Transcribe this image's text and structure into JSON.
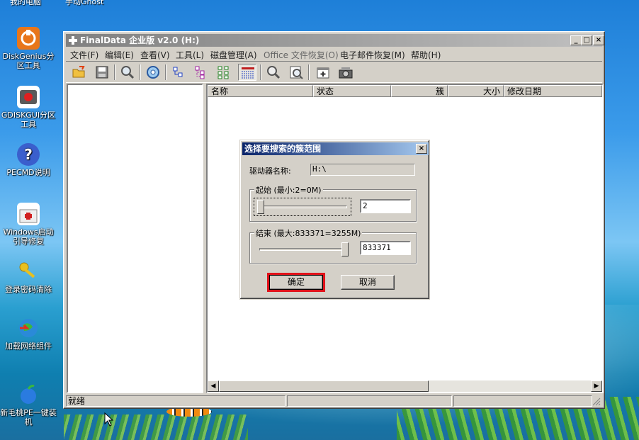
{
  "desktop": {
    "partial_labels": [
      "我的电脑",
      "手动Ghost"
    ],
    "icons": [
      {
        "label": "DiskGenius分区工具",
        "icon": "diskgenius-icon",
        "color": "#e8761a"
      },
      {
        "label": "GDISKGUI分区工具",
        "icon": "gdiskgui-icon",
        "color": "#5a5a5a"
      },
      {
        "label": "PECMD说明",
        "icon": "help-icon",
        "color": "#3a5fcd"
      },
      {
        "label": "Windows启动引导修复",
        "icon": "toolbox-icon",
        "color": "#d02020"
      },
      {
        "label": "登录密码清除",
        "icon": "key-icon",
        "color": "#e8c020"
      },
      {
        "label": "加载网络组件",
        "icon": "globe-icon",
        "color": "#2a8ad8"
      },
      {
        "label": "新毛桃PE一键装机",
        "icon": "peach-icon",
        "color": "#2a7be0"
      }
    ]
  },
  "window": {
    "title": "FinalData 企业版 v2.0 (H:)",
    "controls": {
      "minimize": "_",
      "maximize": "□",
      "close": "×"
    },
    "menu": [
      {
        "label": "文件(F)",
        "enabled": true
      },
      {
        "label": "编辑(E)",
        "enabled": true
      },
      {
        "label": "查看(V)",
        "enabled": true
      },
      {
        "label": "工具(L)",
        "enabled": true
      },
      {
        "label": "磁盘管理(A)",
        "enabled": true
      },
      {
        "label": "Office 文件恢复(O)",
        "enabled": false
      },
      {
        "label": "电子邮件恢复(M)",
        "enabled": true
      },
      {
        "label": "帮助(H)",
        "enabled": true
      }
    ],
    "toolbar_icons": [
      "open-folder-icon",
      "save-icon",
      "search-icon",
      "disc-icon",
      "tree-small-icon",
      "tree-medium-icon",
      "tree-large-icon",
      "list-view-icon",
      "magnify-icon",
      "preview-icon",
      "new-window-icon",
      "camera-icon"
    ],
    "columns": [
      "名称",
      "状态",
      "簇",
      "大小",
      "修改日期"
    ],
    "status": {
      "text": "就绪"
    }
  },
  "dialog": {
    "title": "选择要搜索的簇范围",
    "close": "×",
    "drive_label": "驱动器名称:",
    "drive_value": "H:\\",
    "start_group": "起始 (最小:2=0M)",
    "start_value": "2",
    "start_slider_fraction": 0.0,
    "end_group": "结束 (最大:833371=3255M)",
    "end_value": "833371",
    "end_slider_fraction": 1.0,
    "ok_label": "确定",
    "cancel_label": "取消",
    "highlight_color": "#e0121a"
  }
}
